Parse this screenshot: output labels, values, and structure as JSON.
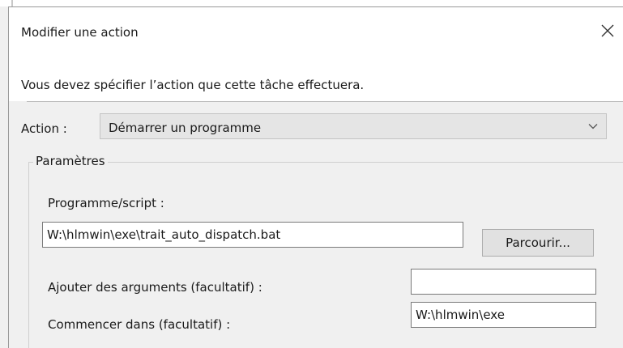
{
  "dialog": {
    "title": "Modifier une action",
    "instruction": "Vous devez spécifier l’action que cette tâche effectuera."
  },
  "action": {
    "label": "Action :",
    "selected": "Démarrer un programme"
  },
  "parameters": {
    "legend": "Paramètres",
    "program_label": "Programme/script :",
    "program_value": "W:\\hlmwin\\exe\\trait_auto_dispatch.bat",
    "browse_label": "Parcourir...",
    "arguments_label": "Ajouter des arguments (facultatif) :",
    "arguments_value": "",
    "start_in_label": "Commencer dans (facultatif) :",
    "start_in_value": "W:\\hlmwin\\exe"
  }
}
